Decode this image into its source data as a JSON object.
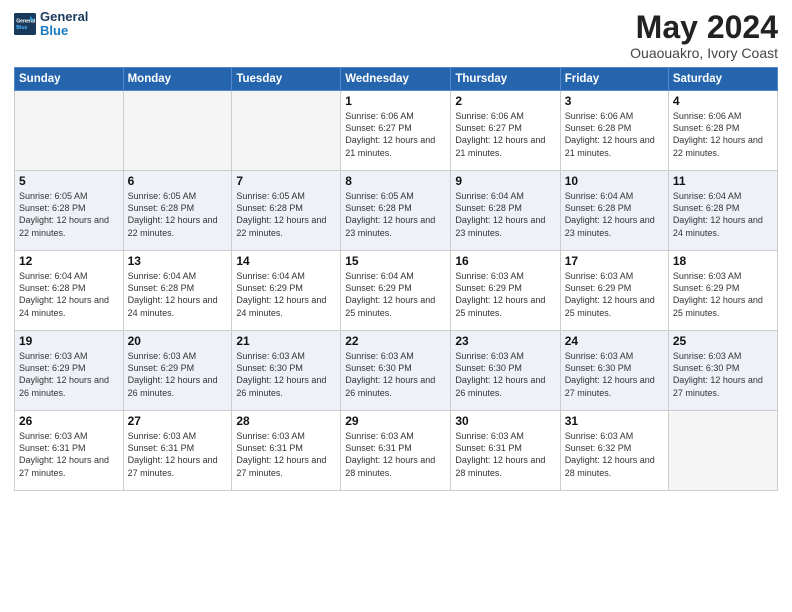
{
  "header": {
    "logo_line1": "General",
    "logo_line2": "Blue",
    "month_year": "May 2024",
    "location": "Ouaouakro, Ivory Coast"
  },
  "weekdays": [
    "Sunday",
    "Monday",
    "Tuesday",
    "Wednesday",
    "Thursday",
    "Friday",
    "Saturday"
  ],
  "weeks": [
    [
      {
        "day": "",
        "empty": true
      },
      {
        "day": "",
        "empty": true
      },
      {
        "day": "",
        "empty": true
      },
      {
        "day": "1",
        "sunrise": "6:06 AM",
        "sunset": "6:27 PM",
        "daylight": "12 hours and 21 minutes."
      },
      {
        "day": "2",
        "sunrise": "6:06 AM",
        "sunset": "6:27 PM",
        "daylight": "12 hours and 21 minutes."
      },
      {
        "day": "3",
        "sunrise": "6:06 AM",
        "sunset": "6:28 PM",
        "daylight": "12 hours and 21 minutes."
      },
      {
        "day": "4",
        "sunrise": "6:06 AM",
        "sunset": "6:28 PM",
        "daylight": "12 hours and 22 minutes."
      }
    ],
    [
      {
        "day": "5",
        "sunrise": "6:05 AM",
        "sunset": "6:28 PM",
        "daylight": "12 hours and 22 minutes."
      },
      {
        "day": "6",
        "sunrise": "6:05 AM",
        "sunset": "6:28 PM",
        "daylight": "12 hours and 22 minutes."
      },
      {
        "day": "7",
        "sunrise": "6:05 AM",
        "sunset": "6:28 PM",
        "daylight": "12 hours and 22 minutes."
      },
      {
        "day": "8",
        "sunrise": "6:05 AM",
        "sunset": "6:28 PM",
        "daylight": "12 hours and 23 minutes."
      },
      {
        "day": "9",
        "sunrise": "6:04 AM",
        "sunset": "6:28 PM",
        "daylight": "12 hours and 23 minutes."
      },
      {
        "day": "10",
        "sunrise": "6:04 AM",
        "sunset": "6:28 PM",
        "daylight": "12 hours and 23 minutes."
      },
      {
        "day": "11",
        "sunrise": "6:04 AM",
        "sunset": "6:28 PM",
        "daylight": "12 hours and 24 minutes."
      }
    ],
    [
      {
        "day": "12",
        "sunrise": "6:04 AM",
        "sunset": "6:28 PM",
        "daylight": "12 hours and 24 minutes."
      },
      {
        "day": "13",
        "sunrise": "6:04 AM",
        "sunset": "6:28 PM",
        "daylight": "12 hours and 24 minutes."
      },
      {
        "day": "14",
        "sunrise": "6:04 AM",
        "sunset": "6:29 PM",
        "daylight": "12 hours and 24 minutes."
      },
      {
        "day": "15",
        "sunrise": "6:04 AM",
        "sunset": "6:29 PM",
        "daylight": "12 hours and 25 minutes."
      },
      {
        "day": "16",
        "sunrise": "6:03 AM",
        "sunset": "6:29 PM",
        "daylight": "12 hours and 25 minutes."
      },
      {
        "day": "17",
        "sunrise": "6:03 AM",
        "sunset": "6:29 PM",
        "daylight": "12 hours and 25 minutes."
      },
      {
        "day": "18",
        "sunrise": "6:03 AM",
        "sunset": "6:29 PM",
        "daylight": "12 hours and 25 minutes."
      }
    ],
    [
      {
        "day": "19",
        "sunrise": "6:03 AM",
        "sunset": "6:29 PM",
        "daylight": "12 hours and 26 minutes."
      },
      {
        "day": "20",
        "sunrise": "6:03 AM",
        "sunset": "6:29 PM",
        "daylight": "12 hours and 26 minutes."
      },
      {
        "day": "21",
        "sunrise": "6:03 AM",
        "sunset": "6:30 PM",
        "daylight": "12 hours and 26 minutes."
      },
      {
        "day": "22",
        "sunrise": "6:03 AM",
        "sunset": "6:30 PM",
        "daylight": "12 hours and 26 minutes."
      },
      {
        "day": "23",
        "sunrise": "6:03 AM",
        "sunset": "6:30 PM",
        "daylight": "12 hours and 26 minutes."
      },
      {
        "day": "24",
        "sunrise": "6:03 AM",
        "sunset": "6:30 PM",
        "daylight": "12 hours and 27 minutes."
      },
      {
        "day": "25",
        "sunrise": "6:03 AM",
        "sunset": "6:30 PM",
        "daylight": "12 hours and 27 minutes."
      }
    ],
    [
      {
        "day": "26",
        "sunrise": "6:03 AM",
        "sunset": "6:31 PM",
        "daylight": "12 hours and 27 minutes."
      },
      {
        "day": "27",
        "sunrise": "6:03 AM",
        "sunset": "6:31 PM",
        "daylight": "12 hours and 27 minutes."
      },
      {
        "day": "28",
        "sunrise": "6:03 AM",
        "sunset": "6:31 PM",
        "daylight": "12 hours and 27 minutes."
      },
      {
        "day": "29",
        "sunrise": "6:03 AM",
        "sunset": "6:31 PM",
        "daylight": "12 hours and 28 minutes."
      },
      {
        "day": "30",
        "sunrise": "6:03 AM",
        "sunset": "6:31 PM",
        "daylight": "12 hours and 28 minutes."
      },
      {
        "day": "31",
        "sunrise": "6:03 AM",
        "sunset": "6:32 PM",
        "daylight": "12 hours and 28 minutes."
      },
      {
        "day": "",
        "empty": true
      }
    ]
  ],
  "labels": {
    "sunrise": "Sunrise:",
    "sunset": "Sunset:",
    "daylight": "Daylight:"
  }
}
